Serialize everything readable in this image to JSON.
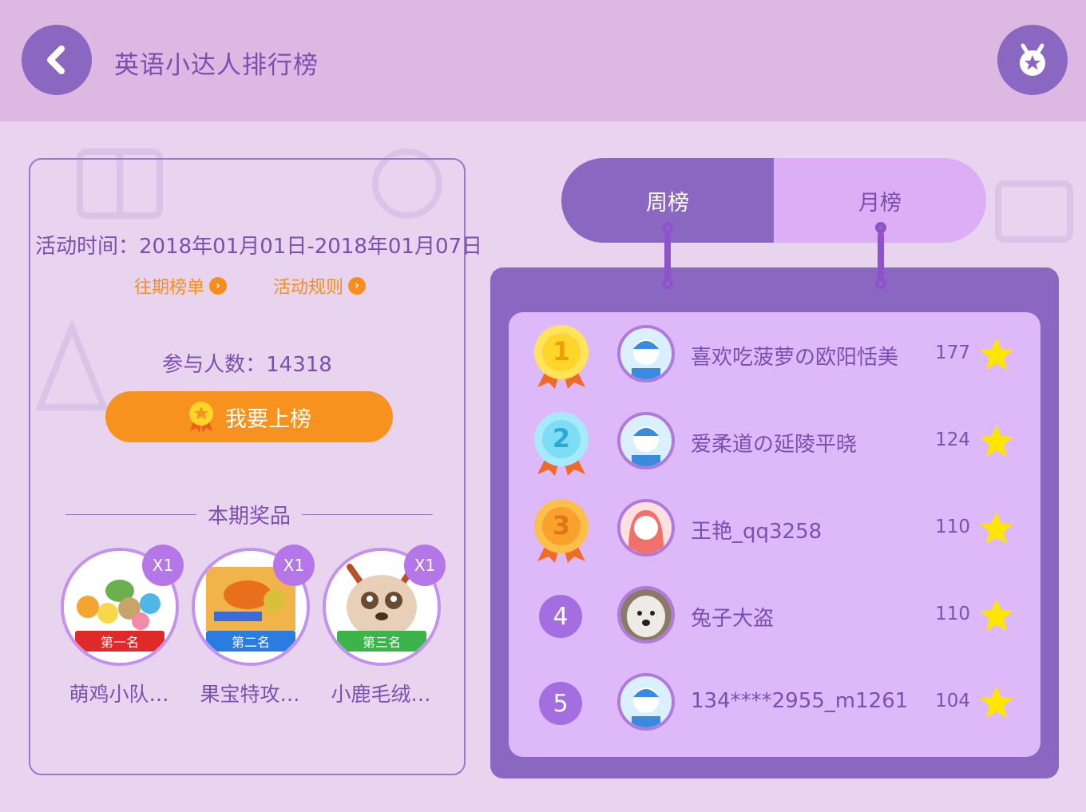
{
  "header": {
    "title": "英语小达人排行榜",
    "back_icon": "chevron-left-icon",
    "medal_icon": "medal-icon"
  },
  "activity": {
    "time_label": "活动时间：2018年01月01日-2018年01月07日",
    "past_link": "往期榜单",
    "rules_link": "活动规则",
    "participants": "参与人数：14318",
    "join_button": "我要上榜"
  },
  "prizes": {
    "heading": "本期奖品",
    "items": [
      {
        "rank": "第一名",
        "qty": "X1",
        "name": "萌鸡小队…",
        "ribbon_color": "#e02a2a"
      },
      {
        "rank": "第二名",
        "qty": "X1",
        "name": "果宝特攻…",
        "ribbon_color": "#2a7ce0"
      },
      {
        "rank": "第三名",
        "qty": "X1",
        "name": "小鹿毛绒…",
        "ribbon_color": "#3bb54a"
      }
    ]
  },
  "tabs": {
    "weekly": "周榜",
    "monthly": "月榜",
    "active": "weekly"
  },
  "ranking": [
    {
      "rank": "1",
      "name": "喜欢吃菠萝の欧阳恬美",
      "score": "177",
      "avatar": "boy",
      "medal_color": "#fdd52c"
    },
    {
      "rank": "2",
      "name": "爱柔道の延陵平晓",
      "score": "124",
      "avatar": "boy",
      "medal_color": "#7fdcf5"
    },
    {
      "rank": "3",
      "name": "王艳_qq3258",
      "score": "110",
      "avatar": "girl",
      "medal_color": "#f9a12a"
    },
    {
      "rank": "4",
      "name": "兔子大盗",
      "score": "110",
      "avatar": "dog"
    },
    {
      "rank": "5",
      "name": "134****2955_m1261",
      "score": "104",
      "avatar": "boy"
    }
  ],
  "colors": {
    "accent": "#8a68c2",
    "orange": "#f7921f",
    "text": "#7b4fb0",
    "star": "#ffe500"
  }
}
